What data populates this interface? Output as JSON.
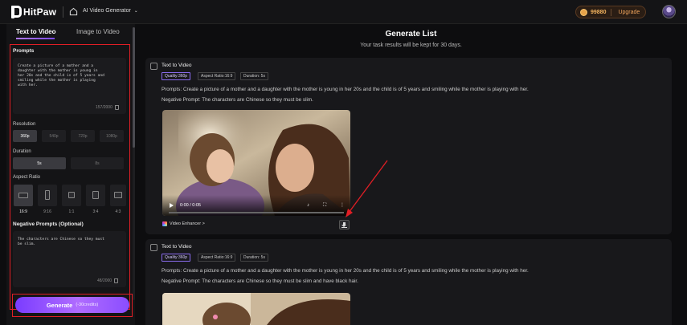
{
  "header": {
    "logo_text": "HitPaw",
    "nav_title": "AI Video Generator",
    "credits": "99880",
    "upgrade_label": "Upgrade",
    "colors": {
      "accent": "#8a4dff",
      "credits": "#f3b35e"
    }
  },
  "sidebar": {
    "tabs": [
      {
        "label": "Text to Video",
        "active": true
      },
      {
        "label": "Image to Video",
        "active": false
      }
    ],
    "prompts_label": "Prompts",
    "prompt_text": "Create a picture of a mother and a daughter with the mother is young in her 20s and the child is of 5 years and smiling while the mother is playing with her.",
    "prompt_count": "157/2000",
    "resolution_label": "Resolution",
    "resolutions": [
      "360p",
      "540p",
      "720p",
      "1080p"
    ],
    "resolution_selected": "360p",
    "duration_label": "Duration",
    "durations": [
      "5s",
      "8s"
    ],
    "duration_selected": "5s",
    "aspect_label": "Aspect Ratio",
    "aspect_ratios": [
      "16:9",
      "9:16",
      "1:1",
      "3:4",
      "4:3"
    ],
    "aspect_selected": "16:9",
    "negative_label": "Negative Prompts (Optional)",
    "negative_text": "The characters are Chinese so they must be slim.",
    "negative_count": "48/2000",
    "generate_label": "Generate",
    "generate_cost": "(-30credits)"
  },
  "main": {
    "title": "Generate List",
    "subtitle": "Your task results will be kept for 30 days.",
    "cards": [
      {
        "title": "Text to Video",
        "tags": [
          "Quality:360p",
          "Aspect Ratio:16:9",
          "Duration: 5s"
        ],
        "prompt": "Prompts:  Create a picture of a mother and a daughter with the mother is young in her 20s and the child is of 5 years and smiling while the mother is playing with her.",
        "negative": "Negative Prompt:  The characters are Chinese so they must be slim.",
        "video_time": "0:00 / 0:05",
        "enhancer_label": "Video Enhancer >"
      },
      {
        "title": "Text to Video",
        "tags": [
          "Quality:360p",
          "Aspect Ratio:16:9",
          "Duration: 5s"
        ],
        "prompt": "Prompts:  Create a picture of a mother and a daughter with the mother is young in her 20s and the child is of 5 years and smiling while the mother is playing with her.",
        "negative": "Negative Prompt:  The characters are Chinese so they must be slim and have black hair."
      }
    ]
  }
}
